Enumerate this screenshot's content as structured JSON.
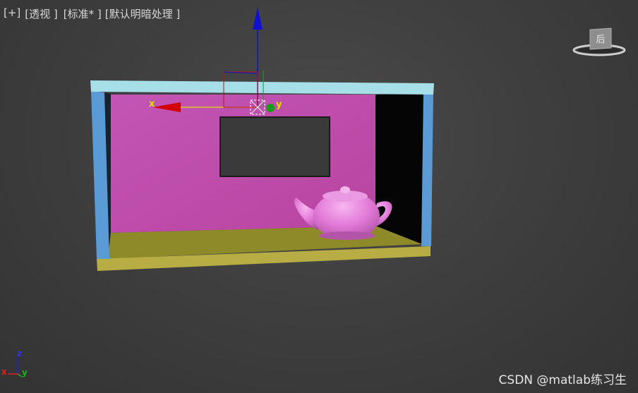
{
  "viewport_labels": {
    "plus": "[+]",
    "view": "透视",
    "shading": "标准*",
    "lighting": "默认明暗处理"
  },
  "viewcube": {
    "face_label": "后"
  },
  "gizmo": {
    "x_label": "x",
    "y_label": "y"
  },
  "axis_tripod": {
    "x": "x",
    "y": "y",
    "z": "z"
  },
  "watermark": "CSDN @matlab练习生",
  "colors": {
    "background": "#404040",
    "frame_blue": "#5b9bd5",
    "frame_top": "#a6dfe8",
    "wall_magenta": "#c050b4",
    "floor": "#8e8a2a",
    "floor_front": "#b8ad45",
    "teapot": "#e07ad8",
    "axis_x": "#d40000",
    "axis_y": "#1a9a1a",
    "axis_z": "#1010d0"
  }
}
